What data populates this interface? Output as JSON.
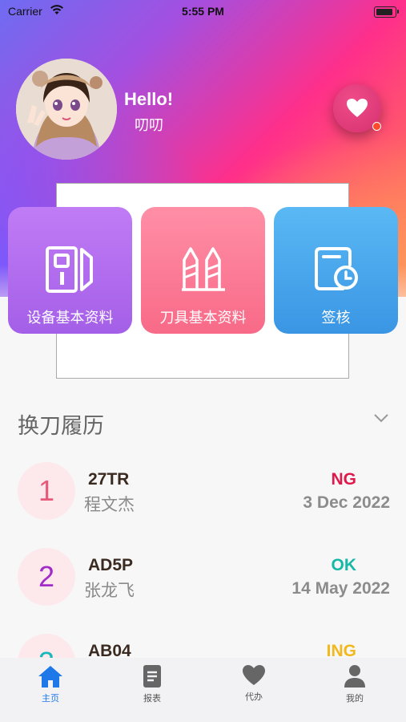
{
  "status_bar": {
    "carrier": "Carrier",
    "time": "5:55 PM"
  },
  "header": {
    "greeting": "Hello!",
    "user_name": "叨叨"
  },
  "tiles": [
    {
      "label": "设备基本资料",
      "icon": "device-icon"
    },
    {
      "label": "刀具基本资料",
      "icon": "tool-icon"
    },
    {
      "label": "签核",
      "icon": "signoff-icon"
    }
  ],
  "history": {
    "title": "换刀履历",
    "items": [
      {
        "index": "1",
        "code": "27TR",
        "name": "程文杰",
        "status": "NG",
        "status_color": "#e0194d",
        "date": "3 Dec 2022",
        "index_color": "#e85a7a"
      },
      {
        "index": "2",
        "code": "AD5P",
        "name": "张龙飞",
        "status": "OK",
        "status_color": "#18b8a8",
        "date": "14 May 2022",
        "index_color": "#a12cc8"
      },
      {
        "index": "3",
        "code": "AB04",
        "name": "",
        "status": "ING",
        "status_color": "#f2b81c",
        "date": "",
        "index_color": "#18b8b8"
      }
    ]
  },
  "tabbar": {
    "active": "主页",
    "items": [
      {
        "label": "主页",
        "icon": "home-icon"
      },
      {
        "label": "报表",
        "icon": "report-icon"
      },
      {
        "label": "代办",
        "icon": "heart-icon"
      },
      {
        "label": "我的",
        "icon": "user-icon"
      }
    ]
  },
  "colors": {
    "accent": "#1e78e8",
    "tile_purple": "#b06ff0",
    "tile_pink": "#f97b95",
    "tile_blue": "#4aa8ee"
  }
}
